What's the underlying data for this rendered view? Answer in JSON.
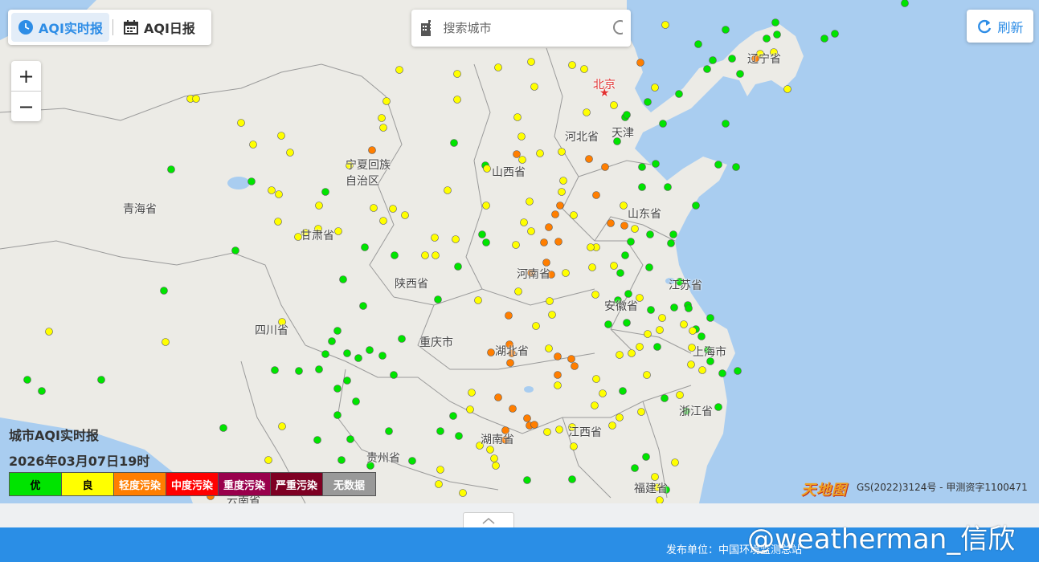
{
  "tabs": [
    {
      "label": "AQI实时报",
      "icon": "clock-icon",
      "active": true
    },
    {
      "label": "AQI日报",
      "icon": "calendar-icon",
      "active": false
    }
  ],
  "search": {
    "placeholder": "搜索城市",
    "icon": "search-icon",
    "building_icon": "building-icon"
  },
  "refresh": {
    "label": "刷新",
    "icon": "refresh-icon"
  },
  "zoom": {
    "in": "+",
    "out": "−"
  },
  "legend": {
    "title": "城市AQI实时报",
    "time": "2026年03月07日19时",
    "levels": [
      {
        "label": "优",
        "color": "#00e400",
        "text_color": "#000000"
      },
      {
        "label": "良",
        "color": "#ffff00",
        "text_color": "#000000"
      },
      {
        "label": "轻度污染",
        "color": "#ff7e00",
        "text_color": "#ffffff"
      },
      {
        "label": "中度污染",
        "color": "#ff0000",
        "text_color": "#ffffff"
      },
      {
        "label": "重度污染",
        "color": "#99004c",
        "text_color": "#ffffff"
      },
      {
        "label": "严重污染",
        "color": "#7e0023",
        "text_color": "#ffffff"
      },
      {
        "label": "无数据",
        "color": "#999999",
        "text_color": "#ffffff"
      }
    ]
  },
  "map": {
    "logo": "天地图",
    "copyright": "GS(2022)3124号 - 甲测资字1100471",
    "places": [
      {
        "name": "北京",
        "capital": true
      },
      {
        "name": "天津"
      },
      {
        "name": "河北省"
      },
      {
        "name": "山西省"
      },
      {
        "name": "山东省"
      },
      {
        "name": "辽宁省"
      },
      {
        "name": "宁夏回族\n自治区"
      },
      {
        "name": "甘肃省"
      },
      {
        "name": "青海省"
      },
      {
        "name": "陕西省"
      },
      {
        "name": "河南省"
      },
      {
        "name": "江苏省"
      },
      {
        "name": "安徽省"
      },
      {
        "name": "上海市"
      },
      {
        "name": "四川省"
      },
      {
        "name": "重庆市"
      },
      {
        "name": "湖北省"
      },
      {
        "name": "浙江省"
      },
      {
        "name": "湖南省"
      },
      {
        "name": "江西省"
      },
      {
        "name": "贵州省"
      },
      {
        "name": "福建省"
      },
      {
        "name": "云南省"
      }
    ]
  },
  "footer": {
    "publisher": "发布单位：中国环境监测总站",
    "watermark": "@weatherman_信欣"
  }
}
